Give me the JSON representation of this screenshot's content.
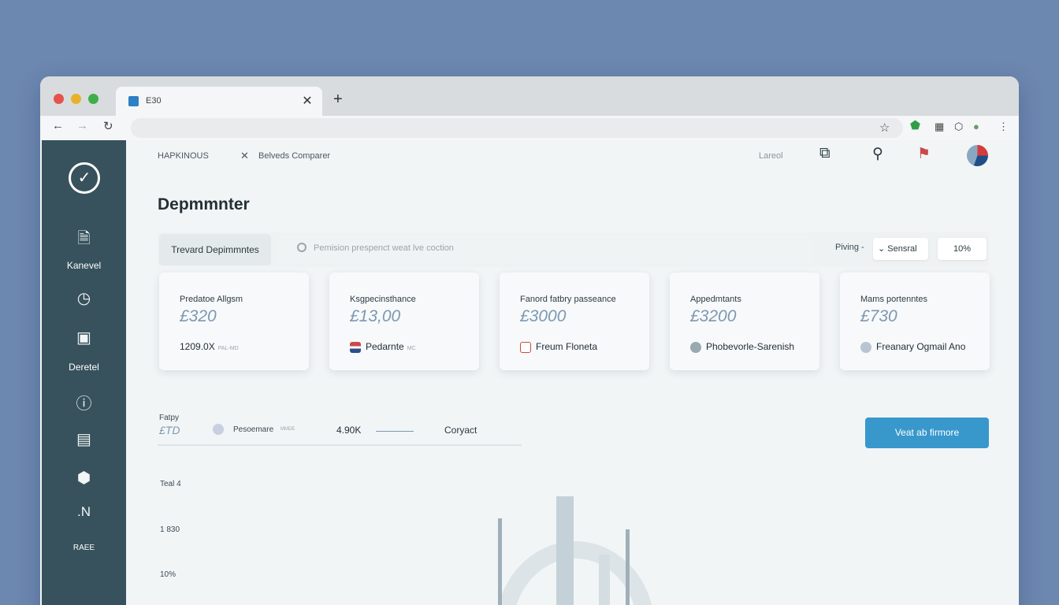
{
  "browser": {
    "tab_title": "E30",
    "tab_close": "✕",
    "new_tab": "+"
  },
  "sidebar": {
    "items": [
      {
        "label": "Kanevel",
        "icon": "document-icon"
      },
      {
        "label": "",
        "icon": "clock-icon"
      },
      {
        "label": "Deretel",
        "icon": "archive-icon"
      },
      {
        "label": "",
        "icon": "alert-icon"
      },
      {
        "label": "",
        "icon": "list-icon"
      },
      {
        "label": "",
        "icon": "cube-icon"
      },
      {
        "label": ".N",
        "icon": "n-icon"
      },
      {
        "label": "RAEE",
        "icon": ""
      }
    ]
  },
  "header": {
    "crumb1": "HAPKINOUS",
    "crumb2": "Belveds Comparer",
    "link": "Lareol"
  },
  "page": {
    "title": "Depmmnter"
  },
  "filter": {
    "tab": "Trevard Depimmntes",
    "search_placeholder": "Pemision prespenct weat lve coction",
    "price_label": "Piving -",
    "sort_label": "Sensral",
    "percent": "10%"
  },
  "cards": [
    {
      "label": "Predatoe Allgsm",
      "value": "£320",
      "bottom": "1209.0X",
      "sub": "PAL-MD"
    },
    {
      "label": "Ksgpecinsthance",
      "value": "£13,00",
      "bottom": "Pedarnte",
      "sub": "MC"
    },
    {
      "label": "Fanord fatbry passeance",
      "value": "£3000",
      "bottom": "Freum Floneta",
      "sub": ""
    },
    {
      "label": "Appedmtants",
      "value": "£3200",
      "bottom": "Phobevorle-Sarenish",
      "sub": ""
    },
    {
      "label": "Mams portenntes",
      "value": "£730",
      "bottom": "Freanary Ogmail Ano",
      "sub": ""
    }
  ],
  "summary": {
    "label": "Fatpy",
    "value": "£TD",
    "item": "Pesoemare",
    "item_sub": "MMDE",
    "amount": "4.90K",
    "contact": "Coryact",
    "button": "Veat ab firmore"
  },
  "chart_axis": [
    "Teal 4",
    "1 830",
    "10%"
  ],
  "colors": {
    "sidebar": "#37525c",
    "accent": "#3898cc",
    "card_value": "#7d98b2"
  }
}
